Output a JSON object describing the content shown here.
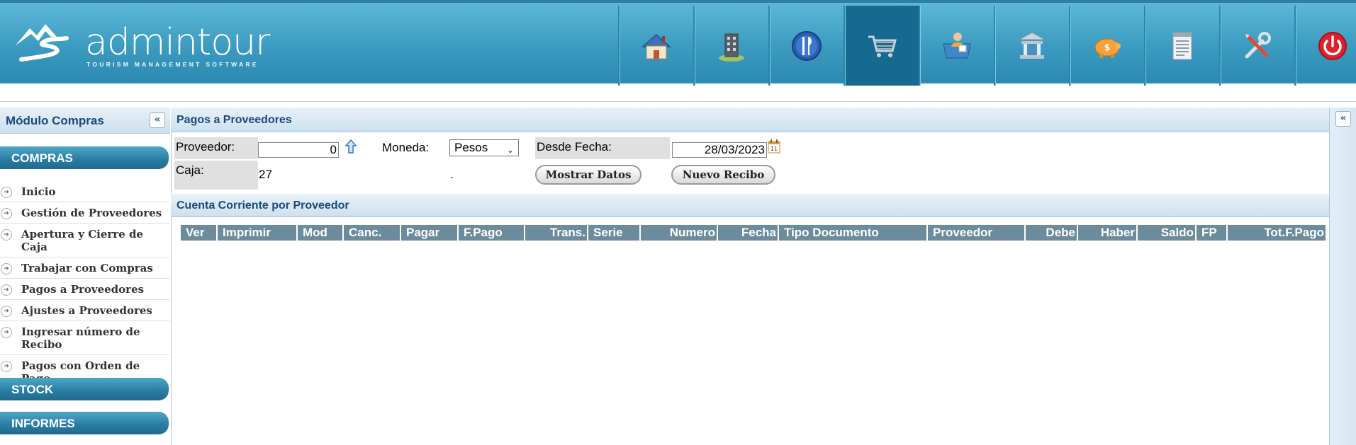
{
  "brand": {
    "name": "admintour",
    "tagline": "TOURISM MANAGEMENT SOFTWARE"
  },
  "nav": [
    {
      "icon": "home-icon"
    },
    {
      "icon": "building-icon"
    },
    {
      "icon": "restaurant-icon"
    },
    {
      "icon": "shopping-cart-icon",
      "active": true
    },
    {
      "icon": "user-folder-icon"
    },
    {
      "icon": "bank-icon"
    },
    {
      "icon": "piggy-bank-icon"
    },
    {
      "icon": "document-list-icon"
    },
    {
      "icon": "tools-icon"
    },
    {
      "icon": "power-icon"
    }
  ],
  "sidebar": {
    "title": "Módulo Compras",
    "collapse_glyph": "«",
    "sections": [
      "COMPRAS",
      "STOCK",
      "INFORMES"
    ],
    "items": [
      "Inicio",
      "Gestión de Proveedores",
      "Apertura y Cierre de Caja",
      "Trabajar con Compras",
      "Pagos a Proveedores",
      "Ajustes a Proveedores",
      "Ingresar número de Recibo",
      "Pagos con Orden de Pago"
    ]
  },
  "main": {
    "title": "Pagos a Proveedores",
    "form": {
      "proveedor_label": "Proveedor:",
      "proveedor_value": "0",
      "moneda_label": "Moneda:",
      "moneda_value": "Pesos",
      "desde_label": "Desde Fecha:",
      "desde_value": "28/03/2023",
      "caja_label": "Caja:",
      "caja_value": "27",
      "dot": ".",
      "mostrar_btn": "Mostrar Datos",
      "nuevo_btn": "Nuevo Recibo"
    },
    "grid": {
      "title": "Cuenta Corriente por Proveedor",
      "columns": [
        "Ver",
        "Imprimir",
        "Mod",
        "Canc.",
        "Pagar",
        "F.Pago",
        "Trans.",
        "Serie",
        "Numero",
        "Fecha",
        "Tipo Documento",
        "Proveedor",
        "Debe",
        "Haber",
        "Saldo",
        "FP",
        "Tot.F.Pago"
      ]
    }
  },
  "right_panel": {
    "collapse_glyph": "«"
  },
  "colors": {
    "banner": "#3c9bc1",
    "nav_active": "#176a8f",
    "section": "#2b7ea5",
    "grid_header": "#6c8b9c",
    "title_text": "#1a4a7a"
  }
}
